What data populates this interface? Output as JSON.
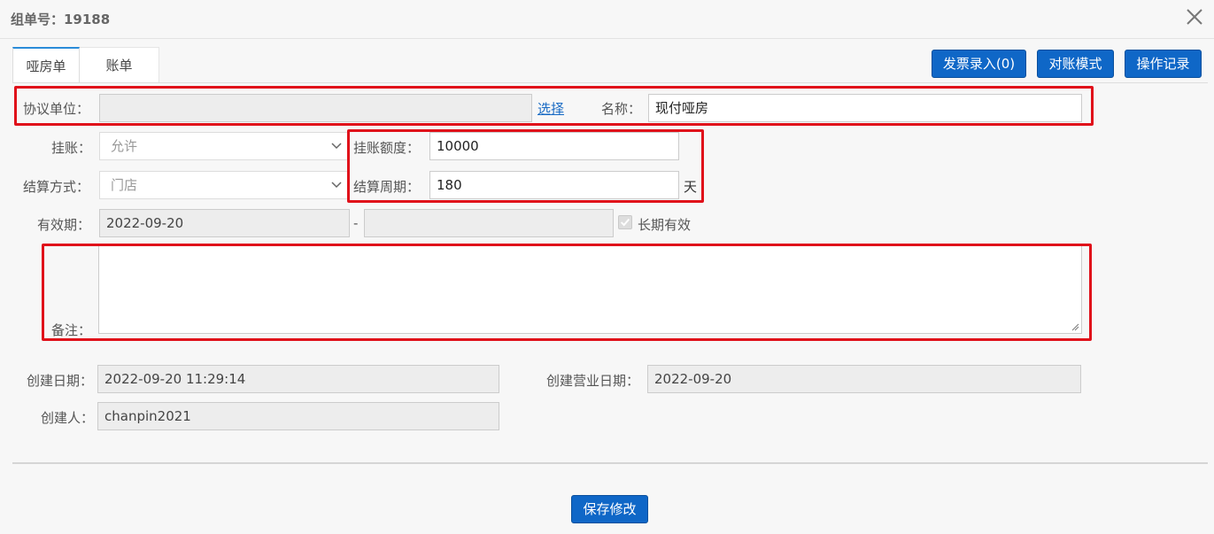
{
  "dialog": {
    "title": "组单号：19188"
  },
  "tabs": [
    {
      "label": "哑房单"
    },
    {
      "label": "账单"
    }
  ],
  "toolbar": {
    "invoice_entry": "发票录入(0)",
    "reconcile_mode": "对账模式",
    "operation_log": "操作记录"
  },
  "form": {
    "agreement_unit": {
      "label": "协议单位：",
      "value": ""
    },
    "select_link": "选择",
    "name": {
      "label": "名称：",
      "value": "现付哑房"
    },
    "credit": {
      "label": "挂账：",
      "value": "允许"
    },
    "credit_limit": {
      "label": "挂账额度：",
      "value": "10000"
    },
    "settlement_method": {
      "label": "结算方式：",
      "value": "门店"
    },
    "settlement_period": {
      "label": "结算周期：",
      "value": "180",
      "unit": "天"
    },
    "validity": {
      "label": "有效期：",
      "start": "2022-09-20",
      "separator": "-",
      "end": "",
      "long_term": "长期有效"
    },
    "remark": {
      "label": "备注：",
      "value": ""
    },
    "created_date": {
      "label": "创建日期：",
      "value": "2022-09-20 11:29:14"
    },
    "created_business_date": {
      "label": "创建营业日期：",
      "value": "2022-09-20"
    },
    "creator": {
      "label": "创建人：",
      "value": "chanpin2021"
    }
  },
  "footer": {
    "save": "保存修改"
  },
  "colors": {
    "primary_button": "#0f67c7",
    "highlight_box": "#e0101a",
    "tab_accent": "#2a8bd8",
    "link": "#1a6bc4"
  },
  "icons": {
    "close": "close-icon",
    "dropdown": "chevron-down-icon",
    "checkbox": "checkmark-icon",
    "resize": "resize-grip-icon"
  }
}
